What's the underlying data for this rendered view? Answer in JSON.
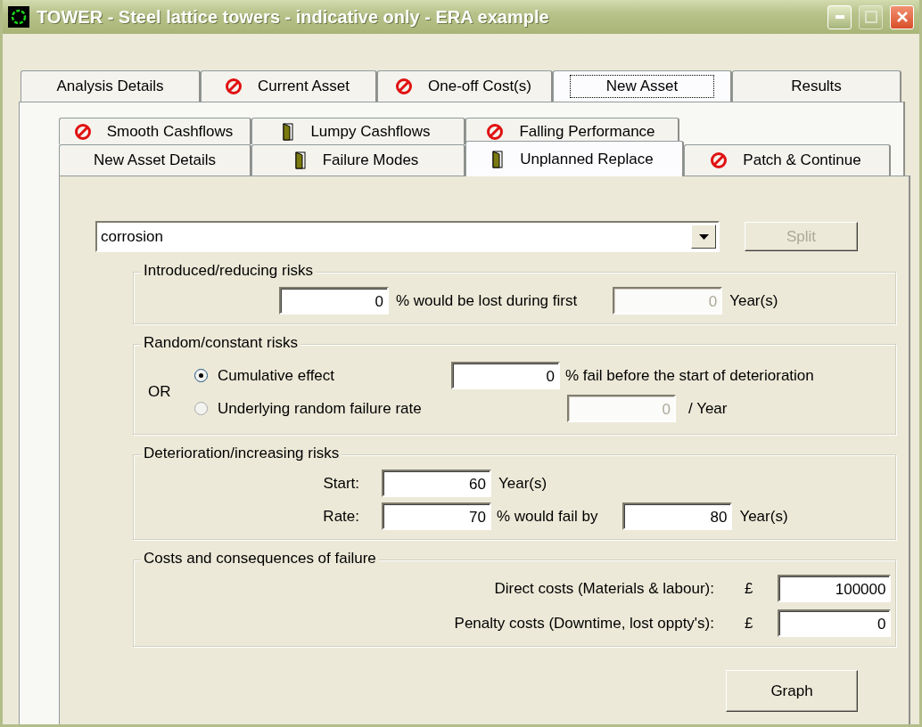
{
  "window": {
    "title": "TOWER - Steel lattice towers - indicative only - ERA example"
  },
  "tabs": [
    {
      "label": "Analysis Details",
      "kind": "plain",
      "selected": false
    },
    {
      "label": "Current Asset",
      "kind": "blocked",
      "selected": false
    },
    {
      "label": "One-off Cost(s)",
      "kind": "blocked",
      "selected": false
    },
    {
      "label": "New Asset",
      "kind": "plain",
      "selected": true
    },
    {
      "label": "Results",
      "kind": "plain",
      "selected": false
    }
  ],
  "sub_tabs_back": [
    {
      "label": "Smooth Cashflows",
      "kind": "blocked",
      "selected": false
    },
    {
      "label": "Lumpy Cashflows",
      "kind": "door",
      "selected": false
    },
    {
      "label": "Falling Performance",
      "kind": "blocked",
      "selected": false
    }
  ],
  "sub_tabs_front": [
    {
      "label": "New Asset Details",
      "kind": "plain",
      "selected": false
    },
    {
      "label": "Failure Modes",
      "kind": "door",
      "selected": false
    },
    {
      "label": "Unplanned Replace",
      "kind": "door",
      "selected": true
    },
    {
      "label": "Patch & Continue",
      "kind": "blocked",
      "selected": false
    }
  ],
  "failure_mode": {
    "value": "corrosion"
  },
  "split_button": {
    "label": "Split",
    "disabled": true
  },
  "introduced": {
    "title": "Introduced/reducing risks",
    "loss": {
      "value": "0",
      "disabled": false
    },
    "loss_text": "% would be lost during first",
    "period": {
      "value": "0",
      "disabled": true
    },
    "period_unit": "Year(s)"
  },
  "random": {
    "title": "Random/constant risks",
    "or_label": "OR",
    "options": [
      {
        "label": "Cumulative effect",
        "selected": true,
        "field": {
          "value": "0",
          "disabled": false
        },
        "unit": "% fail before the start of deterioration"
      },
      {
        "label": "Underlying random failure rate",
        "selected": false,
        "field": {
          "value": "0",
          "disabled": true
        },
        "unit": "/ Year"
      }
    ]
  },
  "deterioration": {
    "title": "Deterioration/increasing risks",
    "start_label": "Start:",
    "start": {
      "value": "60",
      "disabled": false
    },
    "start_unit": "Year(s)",
    "rate_label": "Rate:",
    "rate": {
      "value": "70",
      "disabled": false
    },
    "rate_text": "% would fail by",
    "by": {
      "value": "80",
      "disabled": false
    },
    "by_unit": "Year(s)"
  },
  "costs": {
    "title": "Costs and consequences of failure",
    "rows": [
      {
        "label": "Direct costs (Materials & labour):",
        "currency": "£",
        "field": {
          "value": "100000",
          "disabled": false
        }
      },
      {
        "label": "Penalty costs (Downtime, lost oppty's):",
        "currency": "£",
        "field": {
          "value": "0",
          "disabled": false
        }
      }
    ]
  },
  "graph_button": {
    "label": "Graph",
    "disabled": false
  }
}
